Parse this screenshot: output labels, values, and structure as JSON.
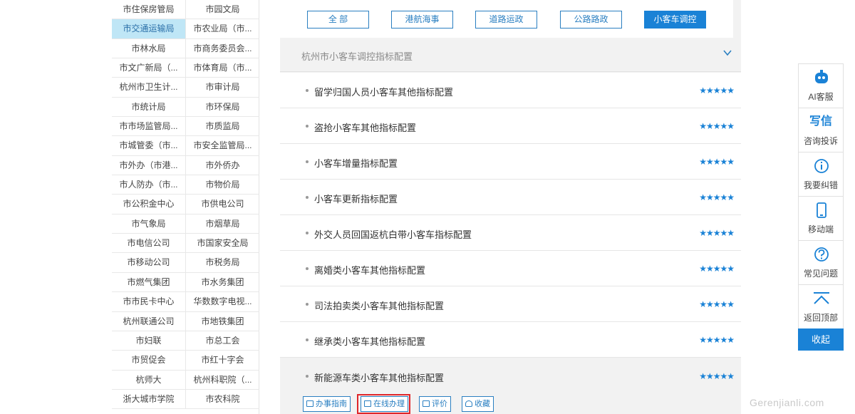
{
  "departments": [
    "市住保房管局",
    "市园文局",
    "市交通运输局",
    "市农业局（市...",
    "市林水局",
    "市商务委员会...",
    "市文广新局（...",
    "市体育局（市...",
    "杭州市卫生计...",
    "市审计局",
    "市统计局",
    "市环保局",
    "市市场监管局...",
    "市质监局",
    "市城管委（市...",
    "市安全监管局...",
    "市外办（市港...",
    "市外侨办",
    "市人防办（市...",
    "市物价局",
    "市公积金中心",
    "市供电公司",
    "市气象局",
    "市烟草局",
    "市电信公司",
    "市国家安全局",
    "市移动公司",
    "市税务局",
    "市燃气集团",
    "市水务集团",
    "市市民卡中心",
    "华数数字电视...",
    "杭州联通公司",
    "市地铁集团",
    "市妇联",
    "市总工会",
    "市贸促会",
    "市红十字会",
    "杭师大",
    "杭州科职院（...",
    "浙大城市学院",
    "市农科院"
  ],
  "active_department_index": 2,
  "filters": [
    "全  部",
    "港航海事",
    "道路运政",
    "公路路政",
    "小客车调控"
  ],
  "active_filter_index": 4,
  "section_title": "杭州市小客车调控指标配置",
  "items": [
    {
      "title": "留学归国人员小客车其他指标配置",
      "stars": "★★★★★",
      "rating": 5
    },
    {
      "title": "盗抢小客车其他指标配置",
      "stars": "★★★★★",
      "rating": 5
    },
    {
      "title": "小客车增量指标配置",
      "stars": "★★★★★",
      "rating": 5
    },
    {
      "title": "小客车更新指标配置",
      "stars": "★★★★★",
      "rating": 5
    },
    {
      "title": "外交人员回国返杭白带小客车指标配置",
      "stars": "★★★★★",
      "rating": 5
    },
    {
      "title": "离婚类小客车其他指标配置",
      "stars": "★★★★★",
      "rating": 5
    },
    {
      "title": "司法拍卖类小客车其他指标配置",
      "stars": "★★★★★",
      "rating": 5
    },
    {
      "title": "继承类小客车其他指标配置",
      "stars": "★★★★★",
      "rating": 5
    },
    {
      "title": "新能源车类小客车其他指标配置",
      "stars": "★★★★★",
      "rating": 5
    }
  ],
  "actions": {
    "guide": "办事指南",
    "online": "在线办理",
    "evaluate": "评价",
    "favorite": "收藏"
  },
  "side_tools": [
    {
      "icon": "robot-icon",
      "label": "AI客服"
    },
    {
      "icon": "write-icon",
      "glyph": "写信",
      "label": "咨询投诉"
    },
    {
      "icon": "info-icon",
      "label": "我要纠错"
    },
    {
      "icon": "mobile-icon",
      "label": "移动端"
    },
    {
      "icon": "question-icon",
      "label": "常见问题"
    },
    {
      "icon": "back-to-top-icon",
      "label": "返回顶部"
    }
  ],
  "collapse_label": "收起",
  "watermark": "Gerenjianli.com",
  "colors": {
    "accent": "#1a82d6",
    "highlight": "#e0262a",
    "active_bg": "#bfe6f6"
  }
}
